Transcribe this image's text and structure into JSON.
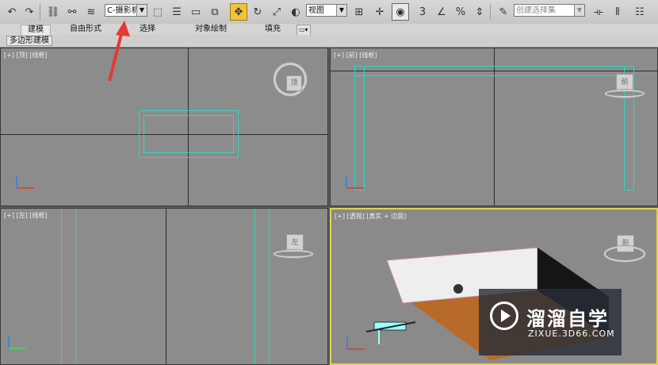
{
  "toolbar": {
    "camera_dropdown": "C-摄影机",
    "view_dropdown": "视图",
    "snap_label": "3",
    "percent_label": "%",
    "selection_set_placeholder": "创建选择集",
    "icons": [
      "undo-icon",
      "redo-icon",
      "link-icon",
      "unlink-icon",
      "bind-space-warp-icon",
      "select-object-icon",
      "select-by-name-icon",
      "rect-region-icon",
      "window-crossing-icon",
      "move-icon",
      "rotate-icon",
      "scale-icon",
      "ref-coord-icon",
      "pivot-icon",
      "manipulate-icon",
      "snap-icon",
      "angle-snap-icon",
      "percent-snap-icon",
      "spinner-snap-icon",
      "edit-named-sets-icon",
      "mirror-icon",
      "align-icon",
      "layer-icon"
    ],
    "accent": "#f2c23a"
  },
  "ribbon": {
    "tabs": [
      "建模",
      "自由形式",
      "选择",
      "对象绘制",
      "填充"
    ],
    "active_tab": "建模",
    "subtab": "多边形建模"
  },
  "viewports": {
    "top": {
      "label": "[+] [顶] [线框]",
      "cube_label": "顶"
    },
    "front": {
      "label": "[+] [前] [线框]",
      "cube_label": "前"
    },
    "left": {
      "label": "[+] [左] [线框]",
      "cube_label": "左"
    },
    "persp": {
      "label": "[+] [透视] [真实 + 边面]",
      "cube_label": "前"
    }
  },
  "watermark": {
    "title": "溜溜自学",
    "url": "ZIXUE.3D66.COM"
  },
  "colors": {
    "wire": "#2fd6c0",
    "active_border": "#e3d34a",
    "annotation": "#e53935"
  }
}
